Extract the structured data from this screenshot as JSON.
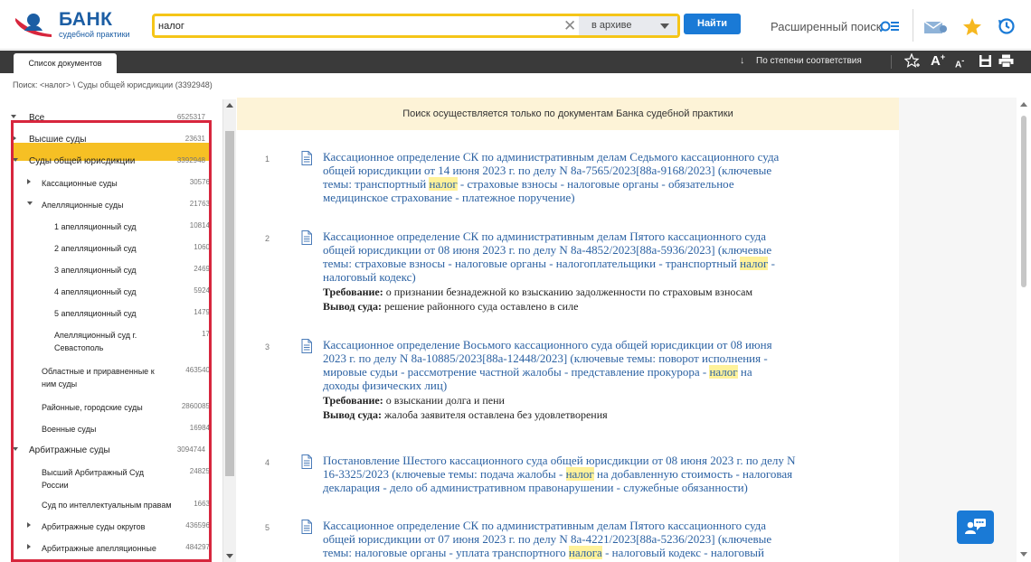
{
  "header": {
    "logo_big": "БАНК",
    "logo_small": "судебной практики",
    "search_value": "налог",
    "search_scope": "в архиве",
    "find_button": "Найти",
    "advanced_search": "Расширенный поиск"
  },
  "tabbar": {
    "tab_label": "Список документов",
    "sort_label": "По степени соответствия",
    "font_up": "A",
    "font_up_sup": "+",
    "font_down": "A",
    "font_down_sup": "-"
  },
  "breadcrumb": "Поиск: <налог> \\ Суды общей юрисдикции (3392948)",
  "tree": [
    {
      "label": "Все",
      "count": "6525317",
      "level": 0,
      "expander": "down"
    },
    {
      "label": "Высшие суды",
      "count": "23631",
      "level": 0,
      "expander": "right"
    },
    {
      "label": "Суды общей юрисдикции",
      "count": "3392948",
      "level": 0,
      "expander": "down",
      "selected": true
    },
    {
      "label": "Кассационные суды",
      "count": "30576",
      "level": 1,
      "expander": "right"
    },
    {
      "label": "Апелляционные суды",
      "count": "21763",
      "level": 1,
      "expander": "down"
    },
    {
      "label": "1 апелляционный суд",
      "count": "10814",
      "level": 2,
      "expander": "none"
    },
    {
      "label": "2 апелляционный суд",
      "count": "1060",
      "level": 2,
      "expander": "none"
    },
    {
      "label": "3 апелляционный суд",
      "count": "2469",
      "level": 2,
      "expander": "none"
    },
    {
      "label": "4 апелляционный суд",
      "count": "5924",
      "level": 2,
      "expander": "none"
    },
    {
      "label": "5 апелляционный суд",
      "count": "1479",
      "level": 2,
      "expander": "none"
    },
    {
      "label": "Апелляционный суд г.",
      "label2": "Севастополь",
      "count": "17",
      "level": 2,
      "expander": "none"
    },
    {
      "label": "Областные и приравненные к",
      "label2": "ним суды",
      "count": "463540",
      "level": 1,
      "expander": "none"
    },
    {
      "label": "Районные, городские суды",
      "count": "2860085",
      "level": 1,
      "expander": "none"
    },
    {
      "label": "Военные суды",
      "count": "16984",
      "level": 1,
      "expander": "none"
    },
    {
      "label": "Арбитражные суды",
      "count": "3094744",
      "level": 0,
      "expander": "down"
    },
    {
      "label": "Высший Арбитражный Суд",
      "label2": "России",
      "count": "24825",
      "level": 1,
      "expander": "none"
    },
    {
      "label": "Суд по интеллектуальным правам",
      "count": "1663",
      "level": 1,
      "expander": "none"
    },
    {
      "label": "Арбитражные суды округов",
      "count": "436596",
      "level": 1,
      "expander": "right"
    },
    {
      "label": "Арбитражные апелляционные",
      "label2": "суды",
      "count": "484297",
      "level": 1,
      "expander": "right"
    }
  ],
  "notice": "Поиск осуществляется только по документам Банка судебной практики",
  "results": [
    {
      "num": "1",
      "title_lines": [
        [
          "Кассационное определение СК по административным делам Седьмого кассационного суда"
        ],
        [
          "общей юрисдикции от 14 июня 2023 г. по делу N 8а-7565/2023[88а-9168/2023] (ключевые"
        ],
        [
          "темы: транспортный ",
          {
            "hl": "налог"
          },
          " - страховые взносы - налоговые органы - обязательное"
        ],
        [
          "медицинское страхование - платежное поручение)"
        ]
      ],
      "req_label": "",
      "req_text": "",
      "out_label": "",
      "out_text": ""
    },
    {
      "num": "2",
      "title_lines": [
        [
          "Кассационное определение СК по административным делам Пятого кассационного суда"
        ],
        [
          "общей юрисдикции от 08 июня 2023 г. по делу N 8а-4852/2023[88а-5936/2023] (ключевые"
        ],
        [
          "темы: страховые взносы - налоговые органы - налогоплательщики - транспортный ",
          {
            "hl": "налог"
          },
          " -"
        ],
        [
          "налоговый кодекс)"
        ]
      ],
      "req_label": "Требование:",
      "req_text": " о признании безнадежной ко взысканию задолженности по страховым взносам",
      "out_label": "Вывод суда:",
      "out_text": " решение районного суда оставлено в силе"
    },
    {
      "num": "3",
      "title_lines": [
        [
          "Кассационное определение Восьмого кассационного суда общей юрисдикции от 08 июня"
        ],
        [
          "2023 г. по делу N 8а-10885/2023[88а-12448/2023] (ключевые темы: поворот исполнения -"
        ],
        [
          "мировые судьи - рассмотрение частной жалобы - представление прокурора - ",
          {
            "hl": "налог"
          },
          " на"
        ],
        [
          "доходы физических лиц)"
        ]
      ],
      "req_label": "Требование:",
      "req_text": " о взыскании долга и пени",
      "out_label": "Вывод суда:",
      "out_text": " жалоба заявителя оставлена без удовлетворения"
    },
    {
      "num": "4",
      "title_lines": [
        [
          "Постановление Шестого кассационного суда общей юрисдикции от 08 июня 2023 г. по делу N"
        ],
        [
          "16-3325/2023 (ключевые темы: подача жалобы - ",
          {
            "hl": "налог"
          },
          " на добавленную стоимость - налоговая"
        ],
        [
          "декларация - дело об административном правонарушении - служебные обязанности)"
        ]
      ],
      "req_label": "",
      "req_text": "",
      "out_label": "",
      "out_text": ""
    },
    {
      "num": "5",
      "title_lines": [
        [
          "Кассационное определение СК по административным делам Пятого кассационного суда"
        ],
        [
          "общей юрисдикции от 07 июня 2023 г. по делу N 8а-4221/2023[88а-5236/2023] (ключевые"
        ],
        [
          "темы: налоговые органы - уплата транспортного ",
          {
            "hl": "налога"
          },
          " - налоговый кодекс - налоговый"
        ]
      ],
      "req_label": "",
      "req_text": "",
      "out_label": "",
      "out_text": ""
    }
  ]
}
